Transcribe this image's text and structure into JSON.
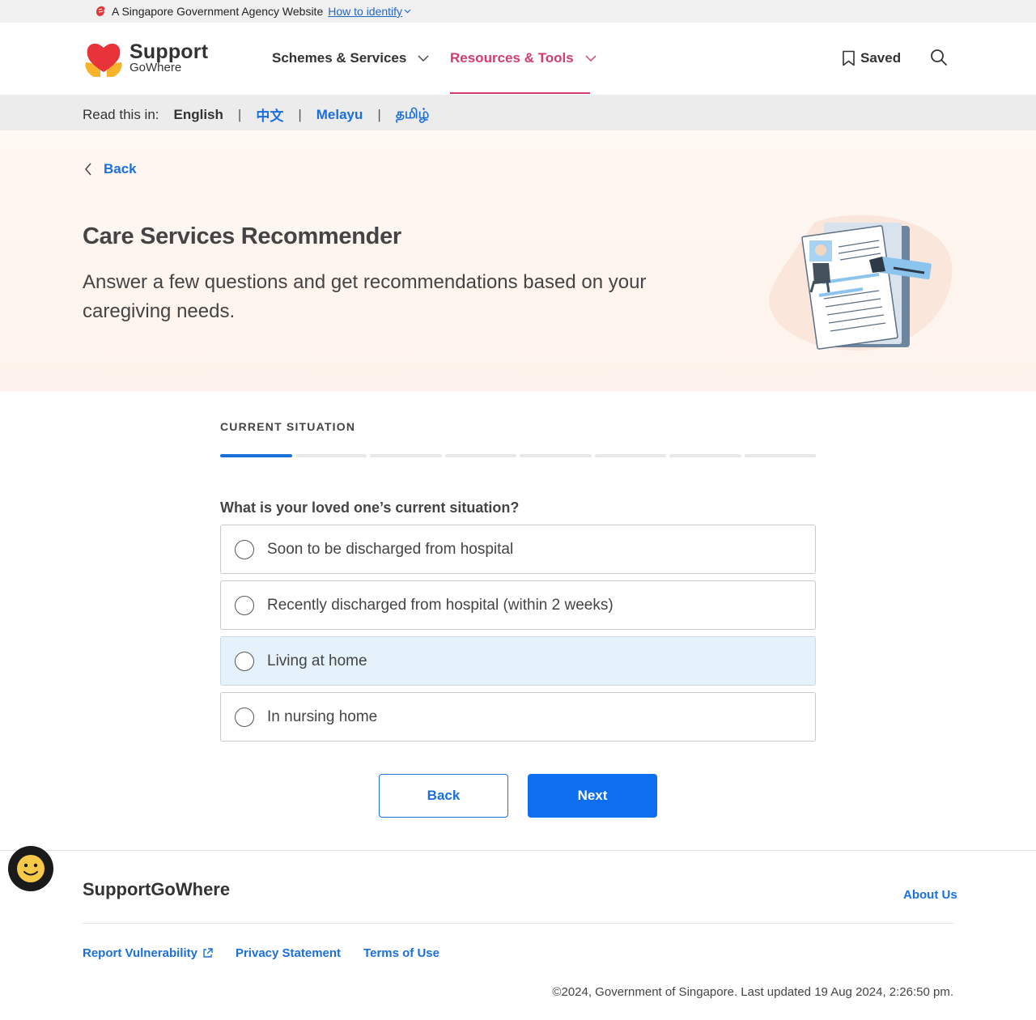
{
  "masthead": {
    "text": "A Singapore Government Agency Website",
    "identify_link": "How to identify"
  },
  "logo": {
    "line1": "Support",
    "line2": "GoWhere"
  },
  "nav": {
    "items": [
      {
        "label": "Schemes & Services"
      },
      {
        "label": "Resources & Tools"
      }
    ],
    "saved": "Saved"
  },
  "langbar": {
    "label": "Read this in:",
    "languages": [
      "English",
      "中文",
      "Melayu",
      "தமிழ்"
    ]
  },
  "hero": {
    "back": "Back",
    "title": "Care Services Recommender",
    "subtitle": "Answer a few questions and get recommendations based on your caregiving needs."
  },
  "step": {
    "label": "CURRENT SITUATION",
    "current": 1,
    "total": 8
  },
  "question": {
    "text": "What is your loved one’s current situation?",
    "options": [
      "Soon to be discharged from hospital",
      "Recently discharged from hospital (within 2 weeks)",
      "Living at home",
      "In nursing home"
    ]
  },
  "buttons": {
    "back": "Back",
    "next": "Next"
  },
  "footer": {
    "brand": "SupportGoWhere",
    "about": "About Us",
    "links": [
      "Report Vulnerability",
      "Privacy Statement",
      "Terms of Use"
    ],
    "copyright": "©2024, Government of Singapore. Last updated 19 Aug 2024, 2:26:50 pm."
  },
  "colors": {
    "accent": "#d23d6e",
    "link": "#1a6fdb",
    "primary_button": "#0d6ff0",
    "hover_option": "#e5f2fc"
  },
  "icons": [
    "lion-head-icon",
    "chevron-down-icon",
    "bookmark-icon",
    "search-icon",
    "chevron-left-icon",
    "external-link-icon",
    "smiley-icon"
  ]
}
